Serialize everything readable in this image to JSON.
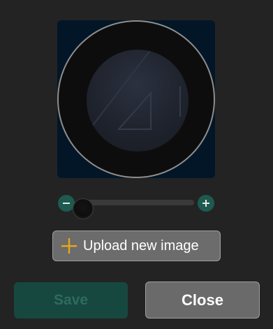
{
  "zoom": {
    "decrease_icon": "minus-icon",
    "increase_icon": "plus-icon",
    "level": 0.03
  },
  "upload": {
    "label": "Upload new image",
    "icon": "plus-icon",
    "icon_color": "#e6a817"
  },
  "actions": {
    "save_label": "Save",
    "close_label": "Close"
  },
  "colors": {
    "background": "#232323",
    "preview_background": "#031628",
    "accent": "#1d5a4f",
    "save_disabled_bg": "#17483f",
    "button_bg": "#6a6a6a"
  }
}
